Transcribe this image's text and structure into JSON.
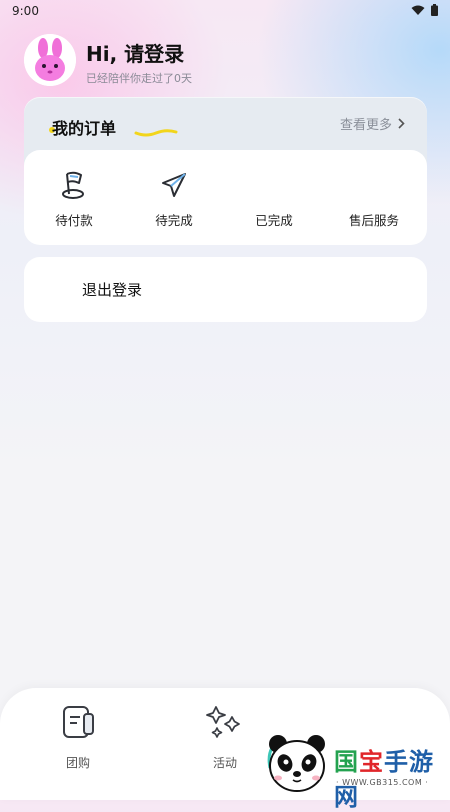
{
  "status_bar": {
    "time": "9:00"
  },
  "profile": {
    "greeting": "Hi, 请登录",
    "days_text": "已经陪伴你走过了0天"
  },
  "orders": {
    "title": "我的订单",
    "more_label": "查看更多",
    "items": [
      {
        "label": "待付款",
        "icon": "flag-icon"
      },
      {
        "label": "待完成",
        "icon": "paper-plane-icon"
      },
      {
        "label": "已完成",
        "icon": ""
      },
      {
        "label": "售后服务",
        "icon": ""
      }
    ]
  },
  "logout": {
    "label": "退出登录"
  },
  "tabbar": {
    "items": [
      {
        "label": "团购",
        "icon": "group-buy-icon"
      },
      {
        "label": "活动",
        "icon": "sparkle-icon"
      }
    ]
  },
  "watermark": {
    "brand": [
      "国",
      "宝",
      "手游网"
    ],
    "url": "· WWW.GB315.COM ·"
  },
  "colors": {
    "accent_yellow": "#f2d51b",
    "brand_green": "#23a24f",
    "brand_red": "#e0262a",
    "brand_blue": "#1f5fa8"
  }
}
